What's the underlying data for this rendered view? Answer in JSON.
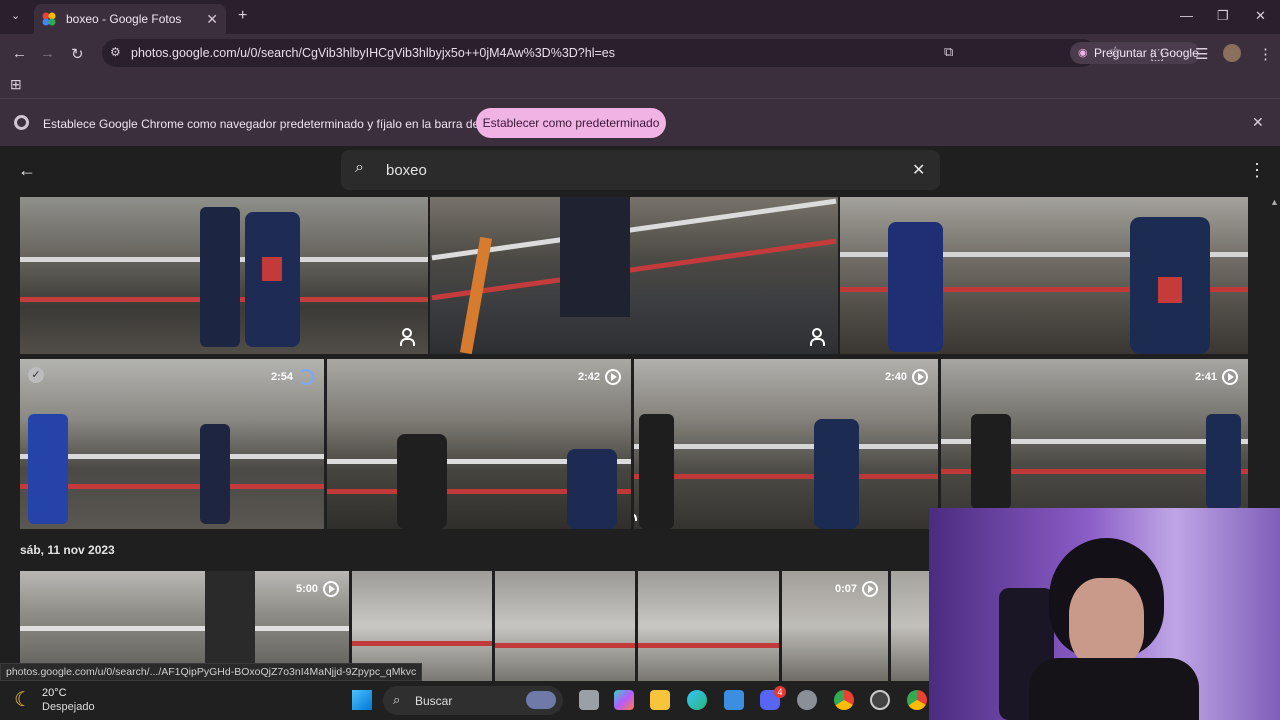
{
  "browser": {
    "tab_title": "boxeo - Google Fotos",
    "new_tab_icon": "plus-icon",
    "url": "photos.google.com/u/0/search/CgVib3hlbyIHCgVib3hlbyjx5o++0jM4Aw%3D%3D?hl=es",
    "ask_google_label": "Preguntar a Google"
  },
  "infobar": {
    "text": "Establece Google Chrome como navegador predeterminado y fíjalo en la barra de tareas",
    "button_label": "Establecer como predeterminado"
  },
  "photos": {
    "search_query": "boxeo",
    "date_label": "sáb, 11 nov 2023",
    "video_durations": [
      "2:54",
      "2:42",
      "2:40",
      "2:41",
      "5:00",
      "0:07"
    ]
  },
  "status_bar_url": "photos.google.com/u/0/search/.../AF1QipPyGHd-BOxoQjZ7o3nI4MaNjjd-9Zpypc_qMkvc",
  "taskbar": {
    "weather_temp": "20°C",
    "weather_desc": "Despejado",
    "search_label": "Buscar",
    "discord_badge": "4"
  },
  "colors": {
    "chrome_frame": "#3b2f3d",
    "infobar_button": "#f0b3e3",
    "photos_bg": "#1f1f1f"
  }
}
